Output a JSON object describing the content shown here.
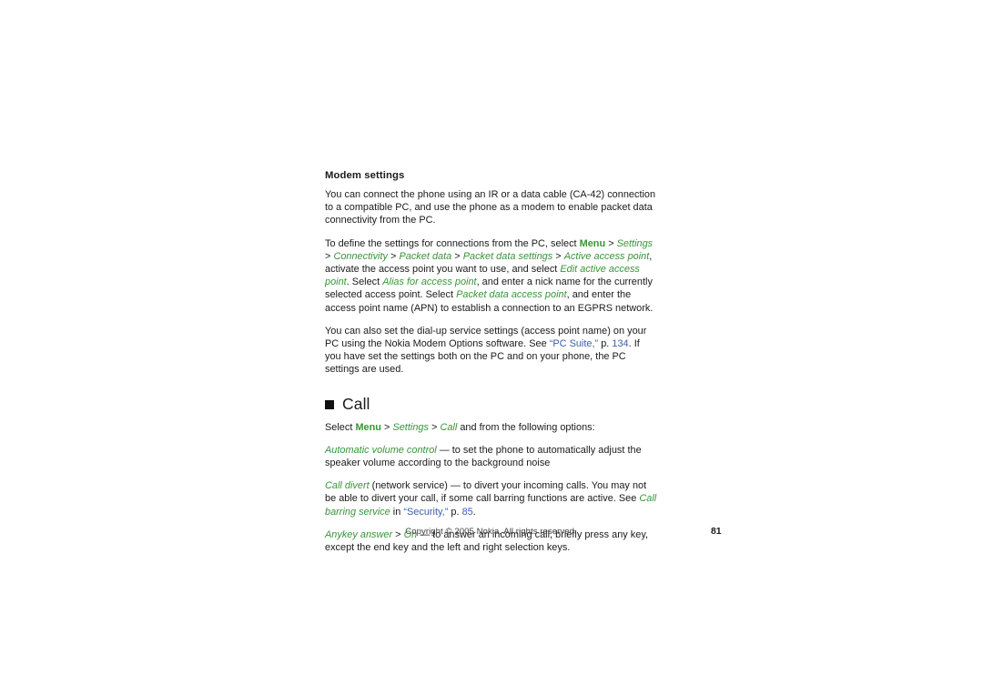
{
  "document": {
    "type": "user-guide-page",
    "page_number": "81",
    "background_color": "#ffffff",
    "text_color": "#1a1a1a",
    "accent_green": "#389438",
    "link_blue": "#3a5fae"
  },
  "subheading": {
    "label": "Modem settings"
  },
  "paragraphs": {
    "p1": {
      "runs": [
        {
          "t": "You can connect the phone using an IR or a data cable (CA-42) connection to a compatible PC, and use the phone as a modem to enable packet data connectivity from the PC.",
          "s": "plain"
        }
      ]
    },
    "p2": {
      "runs": [
        {
          "t": "To define the settings for connections from the PC, select ",
          "s": "plain"
        },
        {
          "t": "Menu",
          "s": "green-bold"
        },
        {
          "t": " > ",
          "s": "plain"
        },
        {
          "t": "Settings",
          "s": "green-italic"
        },
        {
          "t": " > ",
          "s": "plain"
        },
        {
          "t": "Connectivity",
          "s": "green-italic"
        },
        {
          "t": " > ",
          "s": "plain"
        },
        {
          "t": "Packet data",
          "s": "green-italic"
        },
        {
          "t": " > ",
          "s": "plain"
        },
        {
          "t": "Packet data settings",
          "s": "green-italic"
        },
        {
          "t": " > ",
          "s": "plain"
        },
        {
          "t": "Active access point",
          "s": "green-italic"
        },
        {
          "t": ", activate the access point you want to use, and select ",
          "s": "plain"
        },
        {
          "t": "Edit active access point",
          "s": "green-italic"
        },
        {
          "t": ". Select ",
          "s": "plain"
        },
        {
          "t": "Alias for access point",
          "s": "green-italic"
        },
        {
          "t": ", and enter a nick name for the currently selected access point. Select ",
          "s": "plain"
        },
        {
          "t": "Packet data access point",
          "s": "green-italic"
        },
        {
          "t": ", and enter the access point name (APN) to establish a connection to an EGPRS network.",
          "s": "plain"
        }
      ]
    },
    "p3": {
      "runs": [
        {
          "t": "You can also set the dial-up service settings (access point name) on your PC using the Nokia Modem Options software. See ",
          "s": "plain"
        },
        {
          "t": "“PC Suite,”",
          "s": "link"
        },
        {
          "t": " p. ",
          "s": "plain"
        },
        {
          "t": "134",
          "s": "link"
        },
        {
          "t": ". If you have set the settings both on the PC and on your phone, the PC settings are used.",
          "s": "plain"
        }
      ]
    }
  },
  "chapter": {
    "bullet_icon": "square-bullet-icon",
    "title": "Call"
  },
  "call_section": {
    "intro": {
      "runs": [
        {
          "t": "Select ",
          "s": "plain"
        },
        {
          "t": "Menu",
          "s": "green-bold"
        },
        {
          "t": " > ",
          "s": "plain"
        },
        {
          "t": "Settings",
          "s": "green-italic"
        },
        {
          "t": " > ",
          "s": "plain"
        },
        {
          "t": "Call",
          "s": "green-italic"
        },
        {
          "t": " and from the following options:",
          "s": "plain"
        }
      ]
    },
    "options": [
      {
        "name": "automatic-volume-control",
        "runs": [
          {
            "t": "Automatic volume control",
            "s": "green-italic"
          },
          {
            "t": " — to set the phone to automatically adjust the speaker volume according to the background noise",
            "s": "plain"
          }
        ]
      },
      {
        "name": "call-divert",
        "runs": [
          {
            "t": "Call divert",
            "s": "green-italic"
          },
          {
            "t": " (network service) — to divert your incoming calls. You may not be able to divert your call, if some call barring functions are active. See ",
            "s": "plain"
          },
          {
            "t": "Call barring service",
            "s": "green-italic"
          },
          {
            "t": " in ",
            "s": "plain"
          },
          {
            "t": "“Security,”",
            "s": "link"
          },
          {
            "t": " p. ",
            "s": "plain"
          },
          {
            "t": "85",
            "s": "link"
          },
          {
            "t": ".",
            "s": "plain"
          }
        ]
      },
      {
        "name": "anykey-answer",
        "runs": [
          {
            "t": "Anykey answer",
            "s": "green-italic"
          },
          {
            "t": " > ",
            "s": "plain"
          },
          {
            "t": "On",
            "s": "green-italic"
          },
          {
            "t": " — to answer an incoming call, briefly press any key, except the end key and the left and right selection keys.",
            "s": "plain"
          }
        ]
      }
    ]
  },
  "footer": {
    "copyright": "Copyright © 2005 Nokia. All rights reserved.",
    "page_number": "81"
  }
}
